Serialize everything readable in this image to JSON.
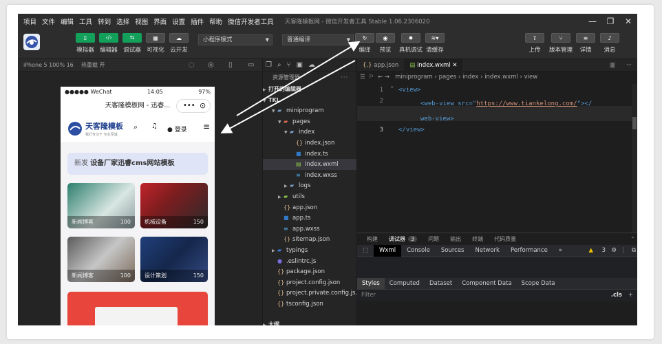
{
  "menu": {
    "items": [
      "项目",
      "文件",
      "编辑",
      "工具",
      "转到",
      "选择",
      "视图",
      "界面",
      "设置",
      "插件",
      "帮助",
      "微信开发者工具"
    ],
    "title": "天客隆模板网 - 微信开发者工具 Stable 1.06.2306020"
  },
  "toolbar": {
    "simulator": "模拟器",
    "editor": "编辑器",
    "debugger": "调试器",
    "visual": "可视化",
    "cloud": "云开发",
    "mode_select": "小程序模式",
    "compile_select": "普通编译",
    "compile": "编译",
    "preview": "预览",
    "real_debug": "真机调试",
    "clear_cache": "清缓存",
    "upload": "上传",
    "version": "版本管理",
    "details": "详情",
    "messages": "消息"
  },
  "simulator": {
    "device": "iPhone 5 100% 16",
    "hotreload": "热重载 开",
    "status": {
      "carrier": "●●●●● WeChat",
      "time": "14:05",
      "battery": "97%"
    },
    "nav_title": "天客隆模板网 - 迅睿...",
    "logo_text": "天客隆模板",
    "logo_sub": "我们专注于 专业至诚",
    "login": "登录",
    "banner_tag": "新发",
    "banner_text": "设备厂家迅睿cms网站模板",
    "cards": [
      {
        "label": "新闻博客",
        "count": "100"
      },
      {
        "label": "机械设备",
        "count": "150"
      },
      {
        "label": "新闻博客",
        "count": "100"
      },
      {
        "label": "设计策划",
        "count": "150"
      }
    ]
  },
  "explorer": {
    "title": "资源管理器",
    "open_editors": "打开的编辑器",
    "project": "TKL",
    "outline": "大纲",
    "tree": [
      {
        "name": "miniprogram",
        "depth": 1,
        "type": "folder",
        "open": true
      },
      {
        "name": "pages",
        "depth": 2,
        "type": "folder-red",
        "open": true
      },
      {
        "name": "index",
        "depth": 3,
        "type": "folder",
        "open": true
      },
      {
        "name": "index.json",
        "depth": 4,
        "type": "json"
      },
      {
        "name": "index.ts",
        "depth": 4,
        "type": "ts"
      },
      {
        "name": "index.wxml",
        "depth": 4,
        "type": "wxml",
        "active": true
      },
      {
        "name": "index.wxss",
        "depth": 4,
        "type": "wxss"
      },
      {
        "name": "logs",
        "depth": 3,
        "type": "folder",
        "open": false
      },
      {
        "name": "utils",
        "depth": 2,
        "type": "folder-green",
        "open": false
      },
      {
        "name": "app.json",
        "depth": 2,
        "type": "json"
      },
      {
        "name": "app.ts",
        "depth": 2,
        "type": "ts"
      },
      {
        "name": "app.wxss",
        "depth": 2,
        "type": "wxss"
      },
      {
        "name": "sitemap.json",
        "depth": 2,
        "type": "json"
      },
      {
        "name": "typings",
        "depth": 1,
        "type": "folder-blue",
        "open": false
      },
      {
        "name": ".eslintrc.js",
        "depth": 1,
        "type": "eslint"
      },
      {
        "name": "package.json",
        "depth": 1,
        "type": "json"
      },
      {
        "name": "project.config.json",
        "depth": 1,
        "type": "json"
      },
      {
        "name": "project.private.config.js...",
        "depth": 1,
        "type": "json"
      },
      {
        "name": "tsconfig.json",
        "depth": 1,
        "type": "json"
      }
    ]
  },
  "editor": {
    "tabs": [
      {
        "label": "app.json"
      },
      {
        "label": "index.wxml"
      }
    ],
    "breadcrumb": [
      "miniprogram",
      "pages",
      "index",
      "index.wxml",
      "view"
    ],
    "code": {
      "l1": "<view>",
      "l2_pre": "<web-view src=\"",
      "l2_url": "https://www.tiankelong.com/",
      "l2_post": "\"></",
      "l2b": "web-view>",
      "l3": "</view>"
    }
  },
  "panel": {
    "tabs": [
      "构建",
      "调试器",
      "3",
      "问题",
      "输出",
      "终端",
      "代码质量"
    ],
    "devtabs": [
      "Wxml",
      "Console",
      "Sources",
      "Network",
      "Performance"
    ],
    "warn": "3",
    "styletabs": [
      "Styles",
      "Computed",
      "Dataset",
      "Component Data",
      "Scope Data"
    ],
    "filter": "Filter",
    "cls": ".cls"
  },
  "colors": {
    "accent_green": "#13a05b",
    "tag": "#569cd6",
    "attr": "#9cdcfe",
    "string": "#ce9178"
  }
}
